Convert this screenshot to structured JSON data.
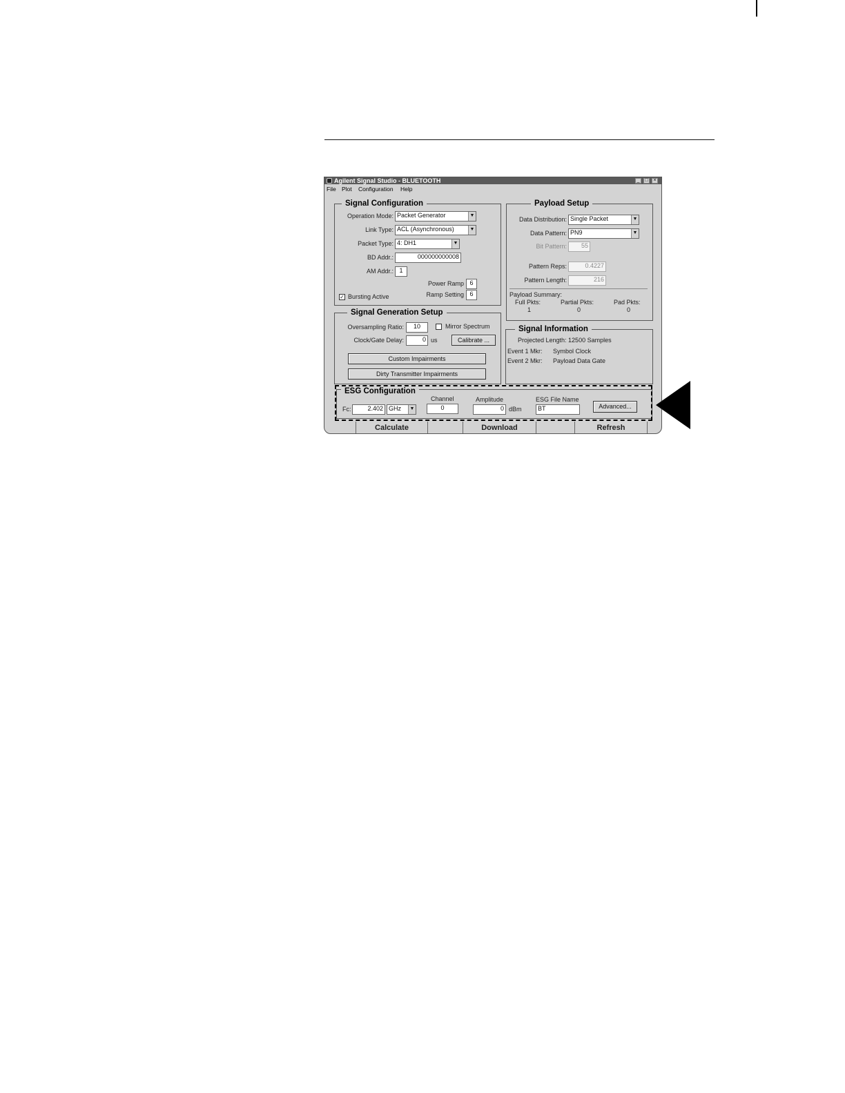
{
  "window": {
    "title": "Agilent Signal Studio - BLUETOOTH"
  },
  "menu": [
    "File",
    "Plot",
    "Configuration",
    "Help"
  ],
  "signal_config": {
    "title": "Signal Configuration",
    "operation_mode": {
      "label": "Operation Mode:",
      "value": "Packet Generator"
    },
    "link_type": {
      "label": "Link Type:",
      "value": "ACL (Asynchronous)"
    },
    "packet_type": {
      "label": "Packet Type:",
      "value": "4: DH1"
    },
    "bd_addr": {
      "label": "BD Addr.:",
      "value": "000000000008"
    },
    "am_addr": {
      "label": "AM Addr.:",
      "value": "1"
    },
    "power_ramp": {
      "label": "Power Ramp",
      "value": "6"
    },
    "ramp_setting": {
      "label": "Ramp Setting",
      "value": "6"
    },
    "bursting_active": {
      "label": "Bursting Active",
      "checked": true
    }
  },
  "signal_gen": {
    "title": "Signal Generation Setup",
    "oversampling": {
      "label": "Oversampling Ratio:",
      "value": "10"
    },
    "mirror_spectrum": {
      "label": "Mirror Spectrum",
      "checked": false
    },
    "clock_gate": {
      "label": "Clock/Gate Delay:",
      "value": "0",
      "unit": "us"
    },
    "calibrate_label": "Calibrate ...",
    "custom_impairments_label": "Custom Impairments",
    "dirty_tx_label": "Dirty Transmitter Impairments"
  },
  "payload": {
    "title": "Payload Setup",
    "data_distribution": {
      "label": "Data Distribution:",
      "value": "Single Packet"
    },
    "data_pattern": {
      "label": "Data Pattern:",
      "value": "PN9"
    },
    "bit_pattern": {
      "label": "Bit Pattern:",
      "value": "55"
    },
    "pattern_reps": {
      "label": "Pattern Reps:",
      "value": "0.4227"
    },
    "pattern_length": {
      "label": "Pattern Length:",
      "value": "216"
    },
    "summary": {
      "label": "Payload Summary:",
      "full_label": "Full Pkts:",
      "full_value": "1",
      "partial_label": "Partial Pkts:",
      "partial_value": "0",
      "pad_label": "Pad Pkts:",
      "pad_value": "0"
    }
  },
  "signal_info": {
    "title": "Signal Information",
    "projected": "Projected Length: 12500 Samples",
    "event1_label": "Event 1 Mkr:",
    "event1_value": "Symbol Clock",
    "event2_label": "Event 2 Mkr:",
    "event2_value": "Payload Data Gate"
  },
  "esg": {
    "title": "ESG Configuration",
    "fc_label": "Fc:",
    "fc_value": "2.402",
    "fc_unit": "GHz",
    "channel_label": "Channel",
    "channel_value": "0",
    "amplitude_label": "Amplitude",
    "amplitude_value": "0",
    "amplitude_unit": "dBm",
    "file_label": "ESG File Name",
    "file_value": "BT",
    "advanced_label": "Advanced..."
  },
  "actions": {
    "calculate": "Calculate",
    "download": "Download",
    "refresh": "Refresh"
  }
}
